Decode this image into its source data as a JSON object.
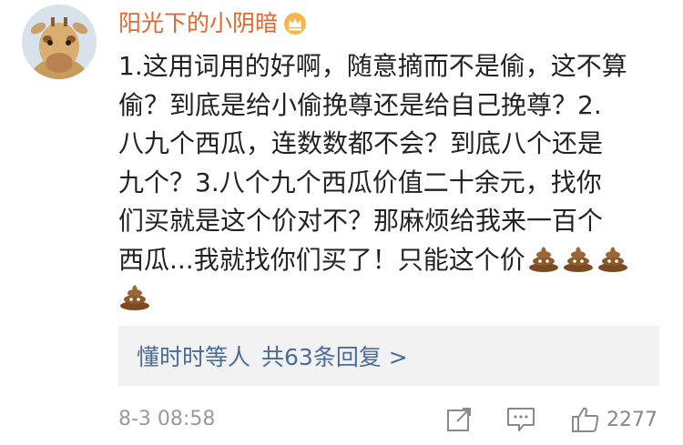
{
  "comment": {
    "username": "阳光下的小阴暗",
    "badge_icon": "vip-crown-icon",
    "lines": [
      "1.这用词用的好啊，随意摘而不是偷，这不算",
      "偷？到底是给小偷挽尊还是给自己挽尊？2.",
      "八九个西瓜，连数数都不会？到底八个还是",
      "九个？3.八个九个西瓜价值二十余元，找你",
      "们买就是这个价对不？那麻烦给我来一百个",
      "西瓜...我就找你们买了！只能这个价"
    ],
    "emoji": "pile-of-poo-icon",
    "timestamp": "8-3 08:58"
  },
  "replies": {
    "preview_user": "懂时时等人",
    "count_label": "共63条回复 >"
  },
  "actions": {
    "repost_icon": "share-icon",
    "comment_icon": "comment-icon",
    "like_icon": "thumbs-up-icon",
    "like_count": "2277"
  },
  "colors": {
    "username": "#e3672d",
    "link": "#4a6c9b",
    "reply_bg": "#f2f2f2",
    "meta": "#9a9a9a"
  }
}
